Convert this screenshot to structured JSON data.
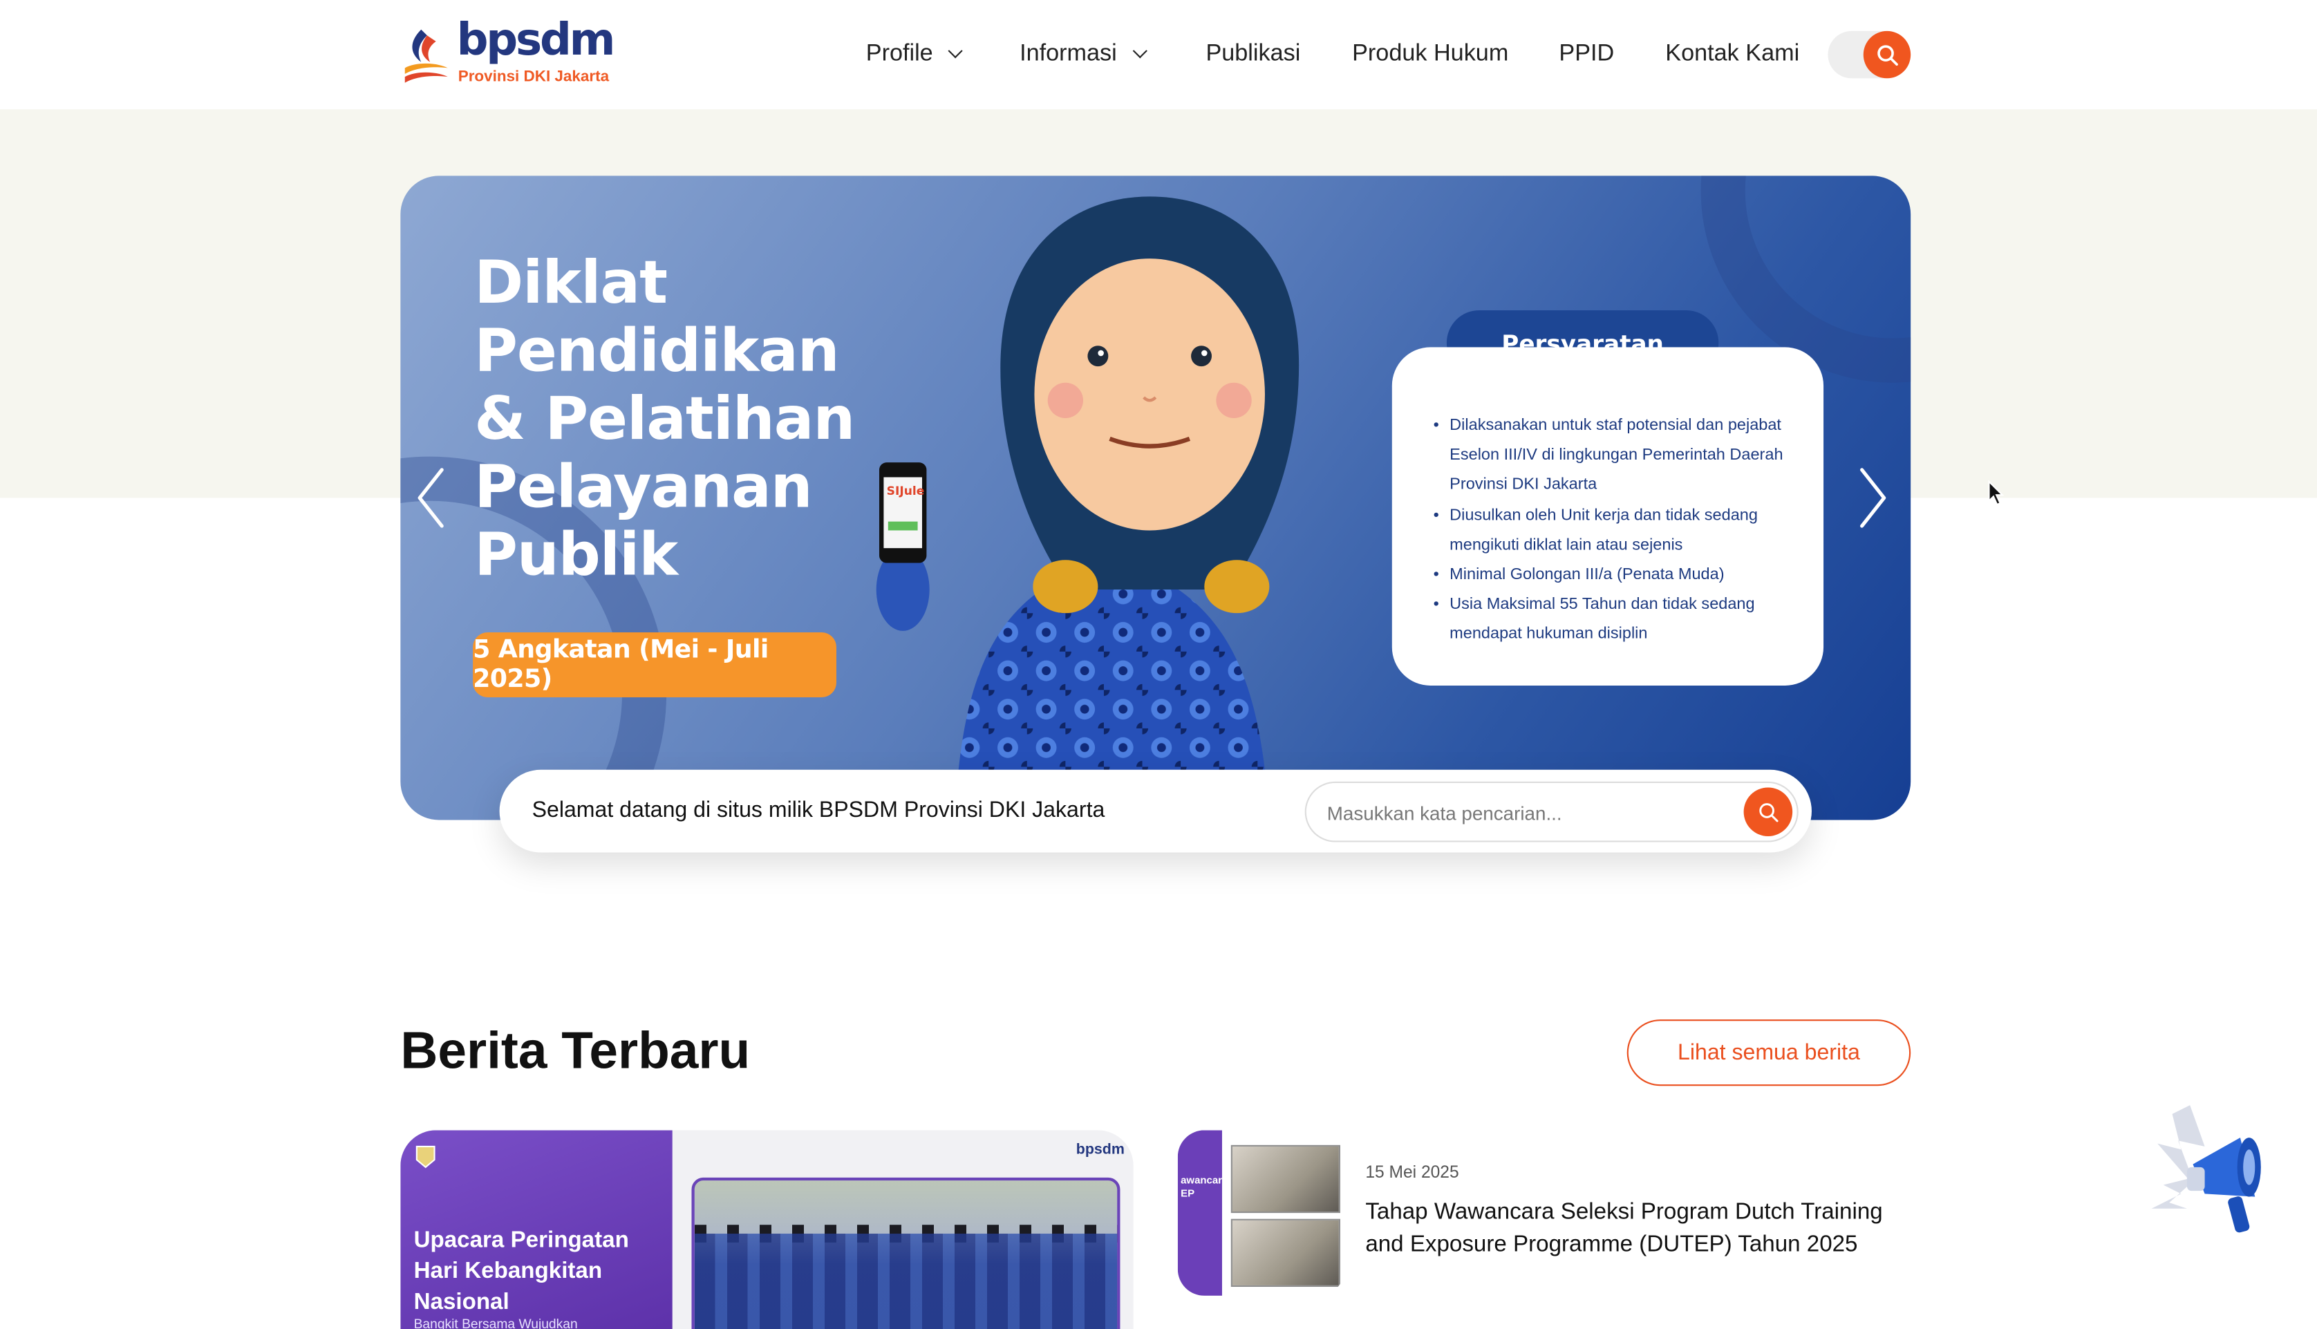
{
  "brand": {
    "logo_word": "bpsdm",
    "logo_sub": "Provinsi DKI Jakarta",
    "accent": "#f0561f"
  },
  "nav": {
    "items": [
      {
        "label": "Profile",
        "has_dropdown": true
      },
      {
        "label": "Informasi",
        "has_dropdown": true
      },
      {
        "label": "Publikasi",
        "has_dropdown": false
      },
      {
        "label": "Produk Hukum",
        "has_dropdown": false
      },
      {
        "label": "PPID",
        "has_dropdown": false
      },
      {
        "label": "Kontak Kami",
        "has_dropdown": false
      }
    ],
    "search_icon": "search-icon"
  },
  "banner": {
    "title_lines": [
      "Diklat",
      "Pendidikan",
      "& Pelatihan",
      "Pelayanan",
      "Publik"
    ],
    "badge": "5 Angkatan (Mei - Juli 2025)",
    "phone_text": "SIJule",
    "requirements_title": "Persyaratan",
    "requirements": [
      "Dilaksanakan untuk staf potensial dan pejabat Eselon III/IV di lingkungan Pemerintah Daerah Provinsi DKI Jakarta",
      "Diusulkan oleh Unit kerja dan tidak sedang mengikuti diklat lain atau sejenis",
      "Minimal Golongan III/a (Penata Muda)",
      "Usia Maksimal 55 Tahun dan tidak sedang mendapat hukuman disiplin"
    ]
  },
  "welcome": {
    "text": "Selamat datang di situs milik BPSDM Provinsi DKI Jakarta",
    "search_placeholder": "Masukkan kata pencarian..."
  },
  "news": {
    "section_title": "Berita Terbaru",
    "see_all": "Lihat semua berita",
    "featured": {
      "title": "Upacara Peringatan Hari Kebangkitan Nasional",
      "subtitle": "Bangkit Bersama Wujudkan",
      "logo_text": "bpsdm"
    },
    "items": [
      {
        "date": "15 Mei 2025",
        "title": "Tahap Wawancara Seleksi Program Dutch Training and Exposure Programme (DUTEP) Tahun 2025",
        "thumb_text": "awancara\nEP"
      }
    ]
  }
}
